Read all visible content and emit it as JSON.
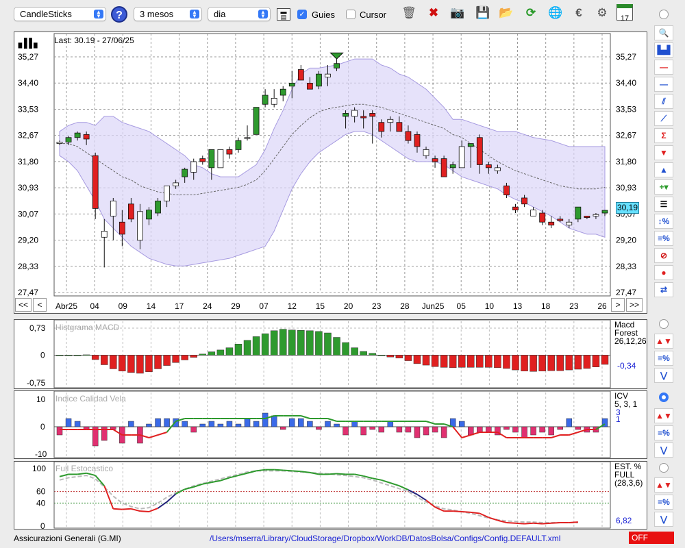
{
  "toolbar": {
    "chart_type": "CandleSticks",
    "period": "3 mesos",
    "interval": "dia",
    "guies_label": "Guies",
    "guies_checked": true,
    "cursor_label": "Cursor",
    "cursor_checked": false,
    "help_label": "?",
    "calendar_day": "17"
  },
  "main_chart": {
    "last_label": "Last: 30.19 - 27/06/25",
    "current_value": "30,19",
    "y_ticks": [
      "35,27",
      "34,40",
      "33,53",
      "32,67",
      "31,80",
      "30,93",
      "30,07",
      "29,20",
      "28,33",
      "27,47"
    ],
    "x_labels": [
      "Abr25",
      "04",
      "09",
      "14",
      "17",
      "24",
      "29",
      "07",
      "12",
      "15",
      "20",
      "23",
      "28",
      "Jun25",
      "05",
      "10",
      "13",
      "18",
      "23",
      "26"
    ],
    "nav": {
      "first": "<<",
      "prev": "<",
      "next": ">",
      "last": ">>"
    }
  },
  "macd": {
    "title": "Histgrama MACD",
    "y_ticks": [
      "0,73",
      "0",
      "-0,75"
    ],
    "right_label_1": "Macd",
    "right_label_2": "Forest",
    "params": "26,12,26",
    "value": "-0,34"
  },
  "icv": {
    "title": "Indice Calidad Vela",
    "y_ticks": [
      "10",
      "0",
      "-10"
    ],
    "right_label": "ICV",
    "params": "5, 3, 1",
    "value_1": "3",
    "value_2": "1"
  },
  "stoch": {
    "title": "Full Estocastico",
    "y_ticks": [
      "100",
      "60",
      "40",
      "0"
    ],
    "right_label_1": "EST. %",
    "right_label_2": "FULL",
    "params": "(28,3,6)",
    "value": "6,82"
  },
  "status": {
    "instrument": "Assicurazioni Generali (G.MI)",
    "path": "/Users/mserra/Library/CloudStorage/Dropbox/WorkDB/DatosBolsa/Configs/Config.DEFAULT.xml",
    "off_label": "OFF"
  },
  "colors": {
    "up": "#2e9a2e",
    "down": "#e02020",
    "band": "#dcd6f8",
    "blue": "#1a22d4",
    "highlight": "#66e0ff"
  },
  "chart_data": [
    {
      "type": "candlestick",
      "ylim": [
        27.47,
        35.27
      ],
      "candles": [
        [
          32.4,
          32.5,
          32.35,
          32.45
        ],
        [
          32.45,
          32.65,
          32.35,
          32.6
        ],
        [
          32.6,
          32.8,
          32.5,
          32.75
        ],
        [
          32.7,
          32.8,
          32.35,
          32.55
        ],
        [
          32.0,
          32.1,
          29.9,
          30.25
        ],
        [
          29.5,
          29.9,
          28.3,
          29.3
        ],
        [
          30.0,
          30.6,
          29.2,
          30.5
        ],
        [
          29.8,
          30.2,
          29.0,
          29.4
        ],
        [
          30.4,
          30.6,
          29.8,
          29.9
        ],
        [
          30.15,
          30.4,
          28.9,
          29.2
        ],
        [
          29.9,
          30.3,
          29.7,
          30.2
        ],
        [
          30.1,
          30.6,
          30.0,
          30.5
        ],
        [
          30.5,
          31.0,
          30.3,
          31.0
        ],
        [
          31.1,
          31.2,
          30.9,
          31.0
        ],
        [
          31.3,
          31.6,
          31.1,
          31.55
        ],
        [
          31.45,
          31.9,
          31.2,
          31.8
        ],
        [
          31.9,
          32.0,
          31.7,
          31.8
        ],
        [
          31.6,
          32.2,
          31.2,
          32.2
        ],
        [
          31.6,
          32.2,
          31.6,
          32.2
        ],
        [
          32.2,
          32.3,
          31.9,
          32.05
        ],
        [
          32.2,
          32.6,
          32.1,
          32.5
        ],
        [
          32.6,
          33.0,
          32.5,
          32.6
        ],
        [
          32.7,
          33.6,
          32.7,
          33.6
        ],
        [
          33.7,
          34.2,
          33.6,
          34.0
        ],
        [
          33.7,
          34.2,
          33.6,
          33.9
        ],
        [
          34.0,
          34.3,
          33.8,
          34.2
        ],
        [
          34.3,
          34.8,
          33.9,
          34.4
        ],
        [
          34.85,
          35.0,
          34.5,
          34.5
        ],
        [
          34.4,
          34.6,
          34.2,
          34.2
        ],
        [
          34.3,
          34.8,
          34.2,
          34.7
        ],
        [
          34.6,
          35.0,
          34.3,
          34.7
        ],
        [
          34.9,
          35.2,
          34.8,
          35.05
        ],
        [
          33.3,
          33.5,
          32.9,
          33.4
        ],
        [
          33.5,
          33.6,
          33.1,
          33.3
        ],
        [
          33.3,
          33.5,
          32.9,
          33.25
        ],
        [
          33.4,
          33.5,
          32.4,
          33.3
        ],
        [
          33.1,
          33.2,
          32.6,
          32.8
        ],
        [
          33.2,
          33.3,
          32.8,
          33.1
        ],
        [
          33.1,
          33.3,
          32.8,
          32.8
        ],
        [
          32.8,
          33.0,
          32.4,
          32.5
        ],
        [
          32.7,
          32.8,
          32.1,
          32.3
        ],
        [
          32.2,
          32.3,
          31.9,
          32.0
        ],
        [
          31.9,
          32.0,
          31.6,
          31.8
        ],
        [
          31.9,
          32.0,
          31.4,
          31.3
        ],
        [
          31.6,
          31.8,
          31.4,
          31.7
        ],
        [
          32.3,
          32.5,
          31.6,
          31.6
        ],
        [
          32.3,
          32.4,
          31.6,
          32.4
        ],
        [
          32.6,
          32.7,
          31.4,
          31.7
        ],
        [
          31.7,
          31.8,
          31.4,
          31.6
        ],
        [
          31.6,
          31.7,
          31.4,
          31.5
        ],
        [
          31.0,
          31.1,
          30.6,
          30.7
        ],
        [
          30.3,
          30.4,
          30.1,
          30.2
        ],
        [
          30.6,
          30.7,
          30.3,
          30.4
        ],
        [
          30.2,
          30.3,
          30.0,
          30.0
        ],
        [
          30.1,
          30.2,
          29.7,
          29.8
        ],
        [
          29.8,
          30.0,
          29.6,
          29.7
        ],
        [
          29.9,
          30.0,
          29.8,
          29.85
        ],
        [
          29.8,
          29.9,
          29.6,
          29.7
        ],
        [
          29.9,
          30.3,
          29.8,
          30.3
        ],
        [
          30.0,
          30.0,
          29.9,
          29.95
        ],
        [
          30.0,
          30.1,
          29.9,
          30.05
        ],
        [
          30.1,
          30.2,
          30.0,
          30.19
        ]
      ],
      "bollinger_upper": [
        32.8,
        33.0,
        33.1,
        33.1,
        33.0,
        33.3,
        33.3,
        33.1,
        33.0,
        32.9,
        32.8,
        32.6,
        32.4,
        32.2,
        32.0,
        31.7,
        31.6,
        31.4,
        31.3,
        31.3,
        31.3,
        31.5,
        31.7,
        32.2,
        32.9,
        33.5,
        34.2,
        34.7,
        34.9,
        34.9,
        34.95,
        35.0,
        35.1,
        35.2,
        35.2,
        35.2,
        35.0,
        34.9,
        34.7,
        34.6,
        34.4,
        34.2,
        33.9,
        33.6,
        33.2,
        33.2,
        33.1,
        33.0,
        32.9,
        32.8,
        32.8,
        32.8,
        32.7,
        32.6,
        32.55,
        32.5,
        32.4,
        32.3,
        32.3,
        32.3,
        32.3,
        32.3
      ],
      "bollinger_lower": [
        32.0,
        31.8,
        31.5,
        31.0,
        30.5,
        29.9,
        29.6,
        29.3,
        29.0,
        28.8,
        28.6,
        28.5,
        28.4,
        28.35,
        28.35,
        28.4,
        28.45,
        28.5,
        28.55,
        28.6,
        28.7,
        28.8,
        28.9,
        29.0,
        29.5,
        30.2,
        30.9,
        31.4,
        31.8,
        32.1,
        32.3,
        32.5,
        32.7,
        32.8,
        32.8,
        32.7,
        32.5,
        32.3,
        32.1,
        31.9,
        31.8,
        31.8,
        31.8,
        31.7,
        31.5,
        31.3,
        31.2,
        31.1,
        31.0,
        30.9,
        30.7,
        30.55,
        30.45,
        30.3,
        30.15,
        30.0,
        29.8,
        29.6,
        29.5,
        29.4,
        29.4,
        29.3
      ],
      "bollinger_mid": [
        32.4,
        32.4,
        32.3,
        32.1,
        31.9,
        31.7,
        31.5,
        31.3,
        31.2,
        31.0,
        30.9,
        30.8,
        30.75,
        30.7,
        30.7,
        30.7,
        30.75,
        30.8,
        30.85,
        30.9,
        30.95,
        31.05,
        31.2,
        31.5,
        31.9,
        32.3,
        32.7,
        33.0,
        33.25,
        33.45,
        33.55,
        33.6,
        33.65,
        33.7,
        33.7,
        33.65,
        33.6,
        33.5,
        33.4,
        33.3,
        33.2,
        33.1,
        33.0,
        32.9,
        32.7,
        32.6,
        32.4,
        32.2,
        32.0,
        31.8,
        31.65,
        31.5,
        31.4,
        31.3,
        31.2,
        31.1,
        31.0,
        30.95,
        30.9,
        30.9,
        30.9,
        30.95
      ]
    },
    {
      "type": "bar",
      "title": "Histgrama MACD",
      "ylim": [
        -0.75,
        0.73
      ],
      "values": [
        0,
        0,
        0,
        0.01,
        -0.12,
        -0.26,
        -0.37,
        -0.43,
        -0.47,
        -0.49,
        -0.45,
        -0.37,
        -0.28,
        -0.2,
        -0.13,
        -0.06,
        0.03,
        0.09,
        0.14,
        0.2,
        0.3,
        0.4,
        0.5,
        0.58,
        0.66,
        0.7,
        0.68,
        0.67,
        0.66,
        0.64,
        0.6,
        0.48,
        0.34,
        0.2,
        0.1,
        0.05,
        0,
        -0.05,
        -0.08,
        -0.15,
        -0.23,
        -0.27,
        -0.31,
        -0.33,
        -0.34,
        -0.33,
        -0.33,
        -0.33,
        -0.33,
        -0.34,
        -0.36,
        -0.4,
        -0.43,
        -0.44,
        -0.43,
        -0.42,
        -0.42,
        -0.4,
        -0.38,
        -0.36,
        -0.32,
        -0.25
      ]
    },
    {
      "type": "bar",
      "title": "Indice Calidad Vela",
      "ylim": [
        -10,
        10
      ],
      "values": [
        -3,
        3,
        2,
        -1,
        -7,
        -5,
        -1,
        -6,
        2,
        -6,
        1,
        3,
        3,
        3,
        2,
        -2,
        1,
        2,
        1,
        2,
        1,
        3,
        2,
        5,
        4,
        -1,
        3,
        3,
        2,
        -1,
        2,
        1,
        -3,
        2,
        -3,
        -1,
        -2,
        2,
        -2,
        -2,
        -4,
        -3,
        -2,
        -4,
        3,
        2,
        -3,
        -2,
        -2,
        -3,
        -1,
        -2,
        -4,
        -3,
        -2,
        -3,
        -1,
        3,
        -1,
        -2,
        -2,
        3
      ],
      "signal": [
        -1,
        -1,
        -1,
        -1,
        -1,
        -1,
        -1,
        -3,
        -3,
        -3,
        -4,
        -3,
        -2,
        2,
        3,
        3,
        3,
        3,
        3,
        3,
        3,
        3,
        3,
        3,
        4,
        4,
        4,
        4,
        3,
        3,
        3,
        2,
        2,
        2,
        2,
        2,
        2,
        2,
        2,
        2,
        2,
        2,
        1,
        1,
        0,
        -4,
        -3,
        -2,
        -2,
        -2,
        -4,
        -4,
        -4,
        -4,
        -4,
        -4,
        -3,
        -3,
        -2,
        -1,
        -1,
        1
      ]
    },
    {
      "type": "line",
      "title": "Full Estocastico",
      "ylim": [
        0,
        100
      ],
      "series": [
        {
          "values": [
            86,
            90,
            90,
            92,
            88,
            70,
            30,
            29,
            30,
            26,
            25,
            31,
            42,
            56,
            64,
            68,
            73,
            76,
            79,
            84,
            88,
            92,
            96,
            98,
            98,
            97,
            96,
            95,
            93,
            90,
            90,
            91,
            90,
            90,
            87,
            83,
            80,
            75,
            70,
            63,
            55,
            45,
            33,
            26,
            26,
            25,
            24,
            22,
            15,
            10,
            6,
            5,
            4,
            5,
            4,
            5,
            6,
            6,
            7
          ]
        },
        {
          "values": [
            80,
            84,
            86,
            88,
            82,
            68,
            52,
            40,
            34,
            30,
            32,
            40,
            50,
            58,
            64,
            70,
            74,
            78,
            82,
            86,
            90,
            94,
            96,
            96,
            96,
            96,
            95,
            94,
            93,
            92,
            91,
            89,
            88,
            86,
            84,
            80,
            75,
            70,
            65,
            60,
            50,
            42,
            35,
            30,
            28,
            25,
            22,
            18,
            14,
            11,
            9,
            8,
            7,
            7,
            6,
            6,
            6,
            6,
            6
          ]
        }
      ]
    }
  ]
}
